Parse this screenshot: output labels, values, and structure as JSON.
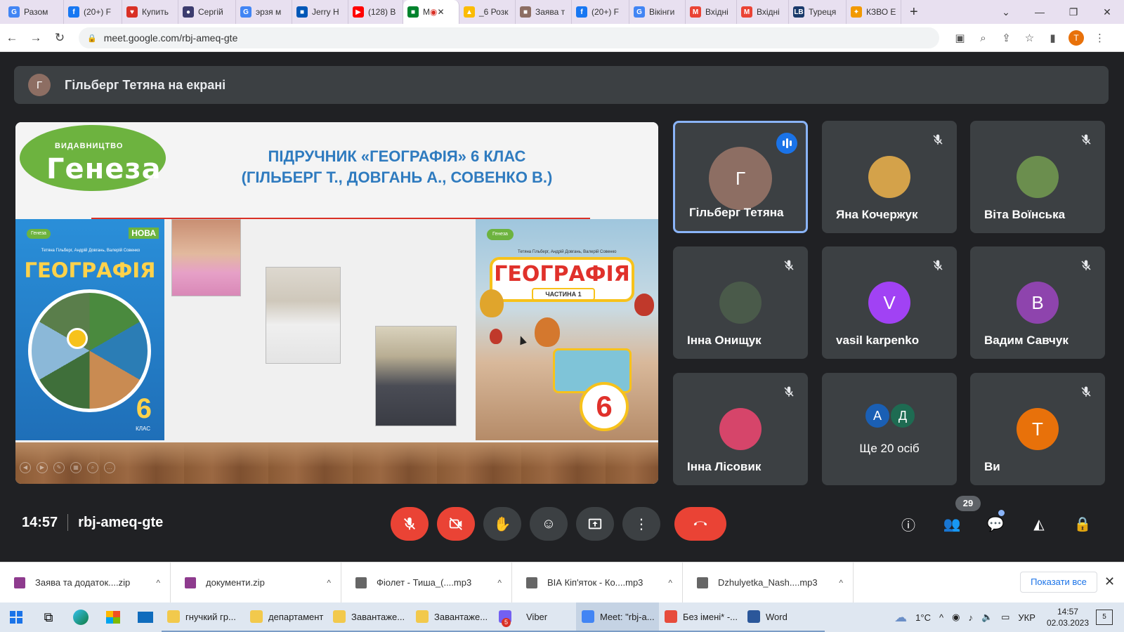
{
  "browser": {
    "tabs": [
      {
        "label": "Разом",
        "color": "#4285f4",
        "glyph": "G"
      },
      {
        "label": "(20+) F",
        "color": "#1877f2",
        "glyph": "f"
      },
      {
        "label": "Купить",
        "color": "#d93025",
        "glyph": "♥"
      },
      {
        "label": "Сергій",
        "color": "#3c3c6e",
        "glyph": "●"
      },
      {
        "label": "эрзя м",
        "color": "#4285f4",
        "glyph": "G"
      },
      {
        "label": "Jerry H",
        "color": "#0057b7",
        "glyph": "■"
      },
      {
        "label": "(128) B",
        "color": "#ff0000",
        "glyph": "▶"
      },
      {
        "label": "M",
        "color": "#00832d",
        "glyph": "■"
      },
      {
        "label": "_6 Розк",
        "color": "#fbbc04",
        "glyph": "▲"
      },
      {
        "label": "Заява т",
        "color": "#8d6e63",
        "glyph": "■"
      },
      {
        "label": "(20+) F",
        "color": "#1877f2",
        "glyph": "f"
      },
      {
        "label": "Вікінги",
        "color": "#4285f4",
        "glyph": "G"
      },
      {
        "label": "Вхідні",
        "color": "#ea4335",
        "glyph": "M"
      },
      {
        "label": "Вхідні",
        "color": "#ea4335",
        "glyph": "M"
      },
      {
        "label": "Туреця",
        "color": "#1a3a6b",
        "glyph": "LB"
      },
      {
        "label": "КЗВО Е",
        "color": "#f29900",
        "glyph": "✦"
      }
    ],
    "url": "meet.google.com/rbj-ameq-gte",
    "profile_initial": "T"
  },
  "presenter": {
    "avatar_initial": "Г",
    "text": "Гільберг Тетяна на екрані"
  },
  "slide": {
    "logo_small": "ВИДАВНИЦТВО",
    "logo_big": "Генеза",
    "title_line1": "ПІДРУЧНИК «ГЕОГРАФІЯ» 6 КЛАС",
    "title_line2": "(ГІЛЬБЕРГ Т., ДОВГАНЬ А., СОВЕНКО В.)",
    "book1": {
      "badge": "Генеза",
      "nova": "НОВА",
      "authors": "Тетяна Гільберг, Андрій Довгань, Валерій Совенко",
      "title": "ГЕОГРАФІЯ",
      "grade": "6",
      "grade_label": "КЛАС"
    },
    "book2": {
      "badge": "Генеза",
      "authors": "Тетяна Гільберг, Андрій Довгань, Валерій Совенко",
      "title": "ГЕОГРАФІЯ",
      "part": "ЧАСТИНА 1",
      "grade": "6"
    }
  },
  "participants": [
    {
      "name": "Гільберг Тетяна",
      "initial": "Г",
      "avatar_color": "#8d6e63",
      "speaking": true,
      "muted": false
    },
    {
      "name": "Яна Кочержук",
      "initial": "",
      "avatar_color": "#d4a24a",
      "speaking": false,
      "muted": true
    },
    {
      "name": "Віта Воїнська",
      "initial": "",
      "avatar_color": "#6b8e4e",
      "speaking": false,
      "muted": true
    },
    {
      "name": "Інна Онищук",
      "initial": "",
      "avatar_color": "#4a5a4a",
      "speaking": false,
      "muted": true
    },
    {
      "name": "vasil karpenko",
      "initial": "V",
      "avatar_color": "#a142f4",
      "speaking": false,
      "muted": true
    },
    {
      "name": "Вадим Савчук",
      "initial": "В",
      "avatar_color": "#8e44ad",
      "speaking": false,
      "muted": true
    },
    {
      "name": "Інна Лісовик",
      "initial": "",
      "avatar_color": "#d6456a",
      "speaking": false,
      "muted": true
    },
    {
      "name": "Ви",
      "initial": "T",
      "avatar_color": "#e8710a",
      "speaking": false,
      "muted": true
    }
  ],
  "more_tile": {
    "label": "Ще 20 осіб",
    "avatars": [
      {
        "initial": "А",
        "color": "#1a5fb4"
      },
      {
        "initial": "Д",
        "color": "#1e6b52"
      }
    ]
  },
  "meeting": {
    "time": "14:57",
    "code": "rbj-ameq-gte",
    "participant_count": "29"
  },
  "downloads": [
    {
      "name": "Заява та додаток....zip",
      "color": "#8e3b8e"
    },
    {
      "name": "документи.zip",
      "color": "#8e3b8e"
    },
    {
      "name": "Фіолет - Тиша_(....mp3",
      "color": "#666"
    },
    {
      "name": "ВІА Кіп'яток - Ко....mp3",
      "color": "#666"
    },
    {
      "name": "Dzhulyetka_Nash....mp3",
      "color": "#666"
    }
  ],
  "downloads_show_all": "Показати все",
  "taskbar": {
    "apps": [
      {
        "name": "гнучкий гр...",
        "color": "#f2c94c",
        "active": false
      },
      {
        "name": "департамент",
        "color": "#f2c94c",
        "active": false
      },
      {
        "name": "Завантаже...",
        "color": "#f2c94c",
        "active": false
      },
      {
        "name": "Завантаже...",
        "color": "#f2c94c",
        "active": false
      },
      {
        "name": "Viber",
        "color": "#7360f2",
        "active": false
      },
      {
        "name": "Meet: \"rbj-a...",
        "color": "#4285f4",
        "active": true
      },
      {
        "name": "Без імені* -...",
        "color": "#e74c3c",
        "active": false
      },
      {
        "name": "Word",
        "color": "#2b579a",
        "active": false
      }
    ],
    "viber_badge": "5",
    "weather": "1°C",
    "lang": "УКР",
    "time": "14:57",
    "date": "02.03.2023",
    "notifications": "5"
  }
}
